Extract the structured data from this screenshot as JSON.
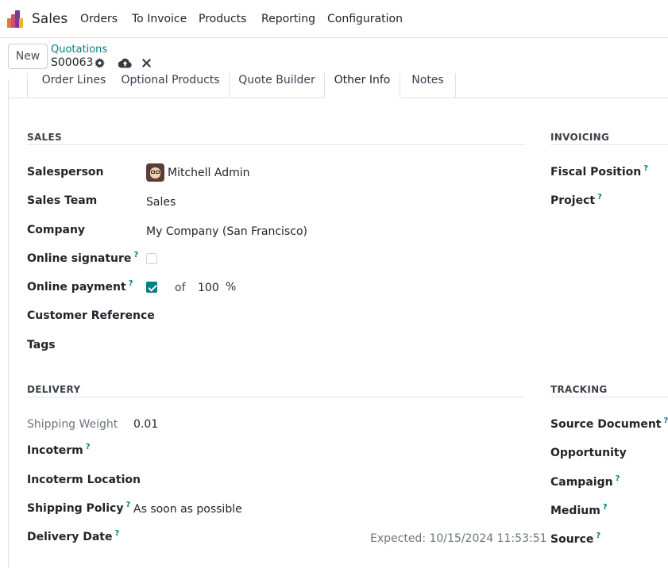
{
  "navbar": {
    "app_name": "Sales",
    "menu": [
      "Orders",
      "To Invoice",
      "Products",
      "Reporting",
      "Configuration"
    ],
    "logo_colors": [
      "#e8753b",
      "#c94e7c",
      "#7a3c8f",
      "#f2b12e"
    ]
  },
  "control_panel": {
    "new_button": "New",
    "breadcrumb_parent": "Quotations",
    "record_name": "S00063",
    "icons": [
      "gear-icon",
      "cloud-upload-icon",
      "close-icon"
    ]
  },
  "tabs": [
    "Order Lines",
    "Optional Products",
    "Quote Builder",
    "Other Info",
    "Notes"
  ],
  "active_tab": "Other Info",
  "sales": {
    "title": "SALES",
    "salesperson_label": "Salesperson",
    "salesperson_value": "Mitchell Admin",
    "sales_team_label": "Sales Team",
    "sales_team_value": "Sales",
    "company_label": "Company",
    "company_value": "My Company (San Francisco)",
    "online_signature_label": "Online signature",
    "online_signature_checked": false,
    "online_payment_label": "Online payment",
    "online_payment_checked": true,
    "online_payment_of": "of",
    "online_payment_percent": "100",
    "online_payment_unit": "%",
    "customer_reference_label": "Customer Reference",
    "tags_label": "Tags"
  },
  "invoicing": {
    "title": "INVOICING",
    "fiscal_position_label": "Fiscal Position",
    "project_label": "Project"
  },
  "delivery": {
    "title": "DELIVERY",
    "shipping_weight_label": "Shipping Weight",
    "shipping_weight_value": "0.01",
    "incoterm_label": "Incoterm",
    "incoterm_location_label": "Incoterm Location",
    "shipping_policy_label": "Shipping Policy",
    "shipping_policy_value": "As soon as possible",
    "delivery_date_label": "Delivery Date",
    "expected_text": "Expected: 10/15/2024 11:53:51"
  },
  "tracking": {
    "title": "TRACKING",
    "source_document_label": "Source Document",
    "opportunity_label": "Opportunity",
    "campaign_label": "Campaign",
    "medium_label": "Medium",
    "source_label": "Source"
  },
  "help_mark": "?",
  "accent_color": "#017e84"
}
